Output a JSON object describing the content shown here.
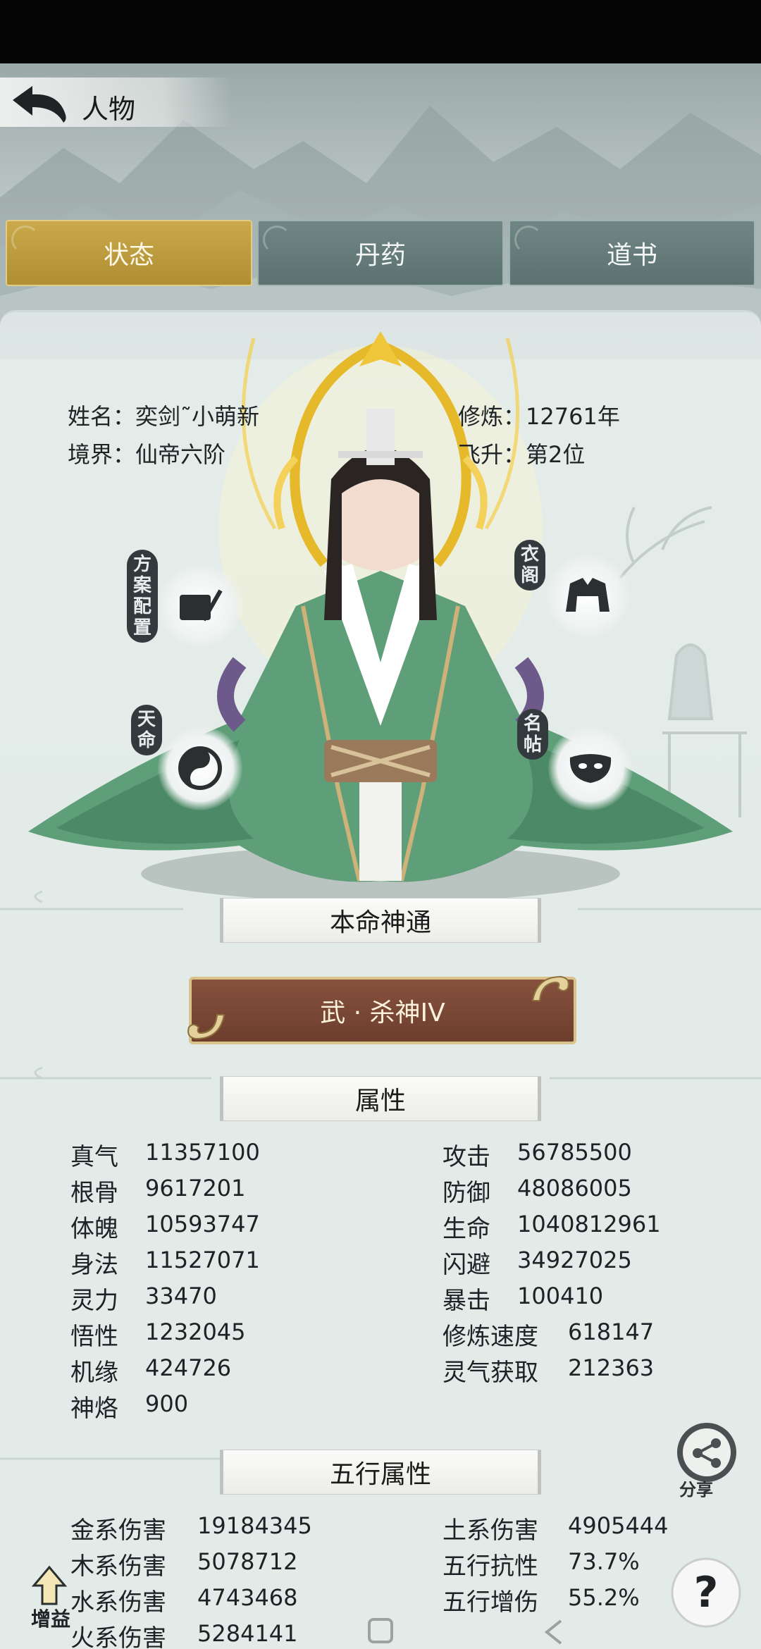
{
  "header": {
    "title": "人物",
    "back_icon": "back-arrow-icon"
  },
  "tabs": [
    {
      "label": "状态",
      "active": true
    },
    {
      "label": "丹药",
      "active": false
    },
    {
      "label": "道书",
      "active": false
    }
  ],
  "profile": {
    "name_label": "姓名：",
    "name_value": "奕剑˜小萌新",
    "realm_label": "境界：",
    "realm_value": "仙帝六阶",
    "cultivate_label": "修炼：",
    "cultivate_value": "12761年",
    "ascend_label": "飞升：",
    "ascend_value": "第2位"
  },
  "side_buttons": {
    "plan": {
      "label": "方案配置",
      "icon": "scroll-brush-icon"
    },
    "wardrobe": {
      "label": "衣阁",
      "icon": "robe-icon"
    },
    "fate": {
      "label": "天命",
      "icon": "taiji-icon"
    },
    "card": {
      "label": "名帖",
      "icon": "mask-icon"
    }
  },
  "innate": {
    "section_title": "本命神通",
    "skill_label": "武 · 杀神IV"
  },
  "attributes": {
    "section_title": "属性",
    "left": [
      {
        "name": "真气",
        "value": "11357100"
      },
      {
        "name": "根骨",
        "value": "9617201"
      },
      {
        "name": "体魄",
        "value": "10593747"
      },
      {
        "name": "身法",
        "value": "11527071"
      },
      {
        "name": "灵力",
        "value": "33470"
      },
      {
        "name": "悟性",
        "value": "1232045"
      },
      {
        "name": "机缘",
        "value": "424726"
      },
      {
        "name": "神烙",
        "value": "900"
      }
    ],
    "right": [
      {
        "name": "攻击",
        "value": "56785500"
      },
      {
        "name": "防御",
        "value": "48086005"
      },
      {
        "name": "生命",
        "value": "1040812961"
      },
      {
        "name": "闪避",
        "value": "34927025"
      },
      {
        "name": "暴击",
        "value": "100410"
      },
      {
        "name": "修炼速度",
        "value": "618147"
      },
      {
        "name": "灵气获取",
        "value": "212363"
      }
    ]
  },
  "elements": {
    "section_title": "五行属性",
    "left": [
      {
        "name": "金系伤害",
        "value": "19184345"
      },
      {
        "name": "木系伤害",
        "value": "5078712"
      },
      {
        "name": "水系伤害",
        "value": "4743468"
      },
      {
        "name": "火系伤害",
        "value": "5284141"
      }
    ],
    "right": [
      {
        "name": "土系伤害",
        "value": "4905444"
      },
      {
        "name": "五行抗性",
        "value": "73.7%"
      },
      {
        "name": "五行增伤",
        "value": "55.2%"
      }
    ]
  },
  "floating": {
    "share_label": "分享",
    "buff_label": "增益",
    "help_icon": "question-icon"
  },
  "colors": {
    "tab_active": "#c9a94a",
    "tab_inactive": "#657c7a",
    "skill_button": "#7a4634",
    "robe_green": "#5e9e78"
  }
}
